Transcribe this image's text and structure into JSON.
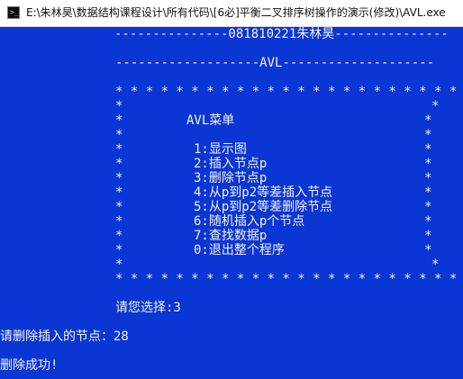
{
  "window": {
    "title": "E:\\朱林昊\\数据结构课程设计\\所有代码\\[6必]平衡二叉排序树操作的演示(修改)\\AVL.exe",
    "icon": "console-app-icon",
    "background_color": "#0a36d4",
    "text_color": "#f2f2f2"
  },
  "console": {
    "header_line": "---------------081810221朱林昊---------------",
    "avl_line": "-------------------AVL--------------------",
    "border_top": "* * * * * * * * * * * * * * * * * * * * * * * * *",
    "border_bottom": "* * * * * * * * * * * * * * * * * * * * * * * * *",
    "border_side": "*",
    "menu_title": "AVL菜单",
    "menu_items": [
      "1:显示图",
      "2:插入节点p",
      "3:删除节点p",
      "4:从p到p2等差插入节点",
      "5:从p到p2等差删除节点",
      "6:随机插入p个节点",
      "7:查找数据p",
      "0:退出整个程序"
    ],
    "choice_prompt": "请您选择:3",
    "delete_prompt": "请删除插入的节点：28",
    "result_message": "删除成功!"
  }
}
